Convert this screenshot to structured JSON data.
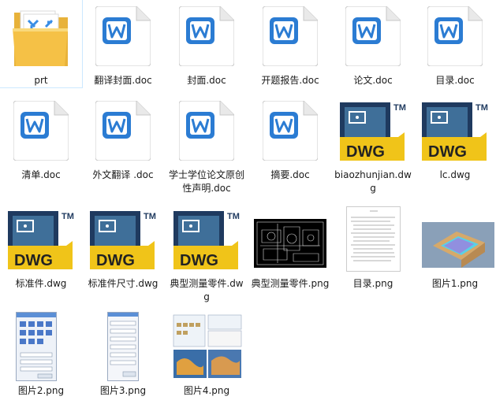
{
  "items": [
    {
      "name": "prt",
      "kind": "folder"
    },
    {
      "name": "翻译封面.doc",
      "kind": "doc"
    },
    {
      "name": "封面.doc",
      "kind": "doc"
    },
    {
      "name": "开题报告.doc",
      "kind": "doc"
    },
    {
      "name": "论文.doc",
      "kind": "doc"
    },
    {
      "name": "目录.doc",
      "kind": "doc"
    },
    {
      "name": "清单.doc",
      "kind": "doc"
    },
    {
      "name": "外文翻译 .doc",
      "kind": "doc"
    },
    {
      "name": "学士学位论文原创性声明.doc",
      "kind": "doc"
    },
    {
      "name": "摘要.doc",
      "kind": "doc"
    },
    {
      "name": "biaozhunjian.dwg",
      "kind": "dwg"
    },
    {
      "name": "lc.dwg",
      "kind": "dwg"
    },
    {
      "name": "标准件.dwg",
      "kind": "dwg"
    },
    {
      "name": "标准件尺寸.dwg",
      "kind": "dwg"
    },
    {
      "name": "典型测量零件.dwg",
      "kind": "dwg"
    },
    {
      "name": "典型测量零件.png",
      "kind": "png-drawing"
    },
    {
      "name": "目录.png",
      "kind": "png-list"
    },
    {
      "name": "图片1.png",
      "kind": "png-3d"
    },
    {
      "name": "图片2.png",
      "kind": "png-dialog"
    },
    {
      "name": "图片3.png",
      "kind": "png-dialog2"
    },
    {
      "name": "图片4.png",
      "kind": "png-collage"
    }
  ],
  "icon_labels": {
    "word_letter": "W",
    "dwg_badge": "DWG",
    "dwg_tm": "TM"
  },
  "colors": {
    "word_blue": "#2b7cd3",
    "dwg_yellow": "#f0c419",
    "dwg_navy": "#1f3a5f",
    "folder": "#f5c146"
  }
}
